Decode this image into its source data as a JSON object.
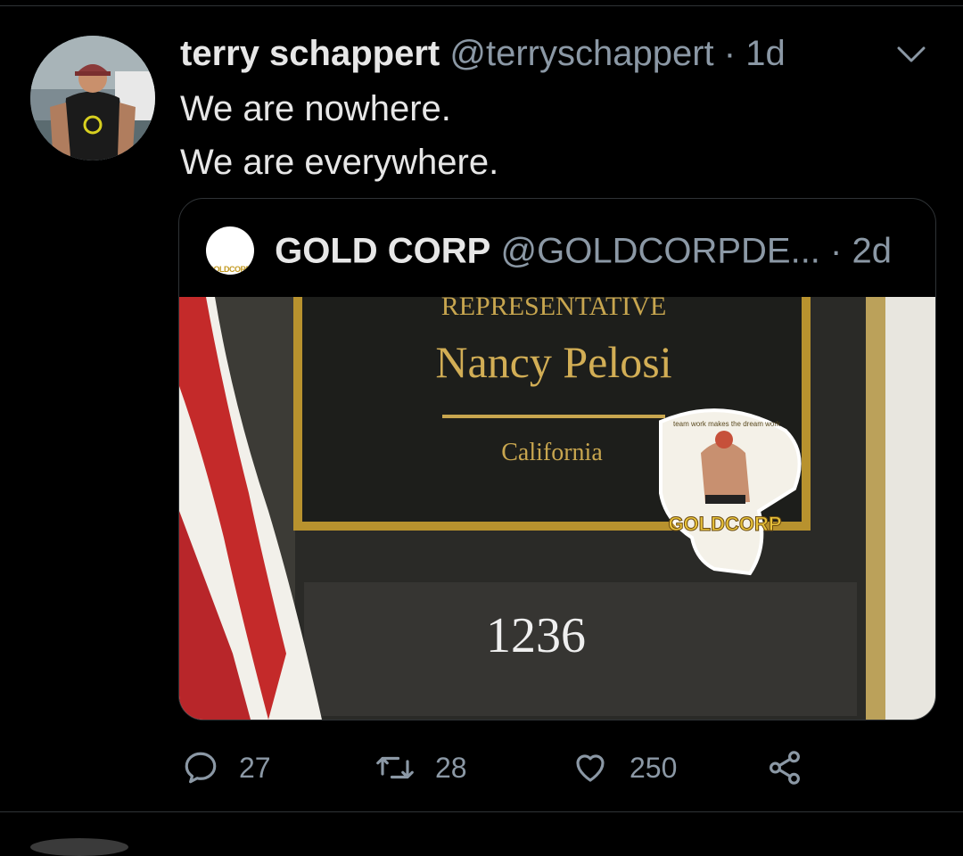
{
  "tweet": {
    "author_name": "terry schappert",
    "author_handle": "@terryschappert",
    "separator": "·",
    "time": "1d",
    "lines": [
      "We are nowhere.",
      "We are everywhere."
    ]
  },
  "quoted": {
    "logo_text": "GOLDCORP",
    "author_name": "GOLD CORP",
    "author_handle": "@GOLDCORPDE...",
    "separator": "·",
    "time": "2d",
    "image": {
      "plaque_title": "REPRESENTATIVE",
      "plaque_name": "Nancy Pelosi",
      "plaque_state": "California",
      "room_number": "1236",
      "sticker_caption": "team work makes the dream work",
      "sticker_brand": "GOLDCORP"
    }
  },
  "actions": {
    "replies": "27",
    "retweets": "28",
    "likes": "250"
  },
  "icons": {
    "reply": "reply-icon",
    "retweet": "retweet-icon",
    "like": "heart-icon",
    "share": "share-icon",
    "menu": "chevron-down-icon"
  },
  "colors": {
    "background": "#000000",
    "secondary_text": "#8b98a5",
    "primary_text": "#e7e7e7",
    "gold": "#c9a227"
  }
}
